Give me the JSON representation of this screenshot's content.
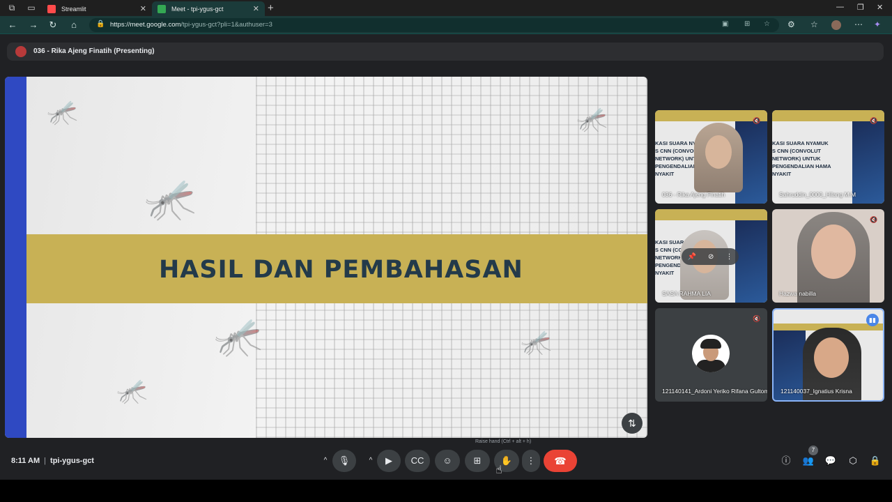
{
  "browser": {
    "tabs": [
      {
        "title": "Streamlit",
        "active": false
      },
      {
        "title": "Meet - tpi-ygus-gct",
        "active": true
      }
    ],
    "url_host": "https://meet.google.com",
    "url_path": "/tpi-ygus-gct?pli=1&authuser=3"
  },
  "meet": {
    "presenter_label": "036 - Rika Ajeng Finatih (Presenting)",
    "slide_title": "HASIL DAN PEMBAHASAN",
    "tile_slide_lines": [
      "KASI SUARA NYAMUK",
      "S CNN (CONVOLUT",
      "NETWORK) UNTUK",
      "PENGENDALIAN HAMA",
      "NYAKIT"
    ],
    "participants": [
      {
        "name": "036 - Rika Ajeng Finatih"
      },
      {
        "name": "Sahruddin_0000_Hilang M.M"
      },
      {
        "name": "SASA RAHMA LIA"
      },
      {
        "name": "Hazwa nabilla"
      },
      {
        "name": "121140141_Ardoni Yeriko Rifana Gultom"
      },
      {
        "name": "121140037_Ignatius Krisna"
      }
    ],
    "time": "8:11 AM",
    "meeting_code": "tpi-ygus-gct",
    "people_count": "7",
    "tooltip": "Raise hand (Ctrl + alt + h)"
  },
  "colors": {
    "slide_band": "#c8b155",
    "slide_side": "#2f49c2",
    "end_call": "#ea4335"
  }
}
